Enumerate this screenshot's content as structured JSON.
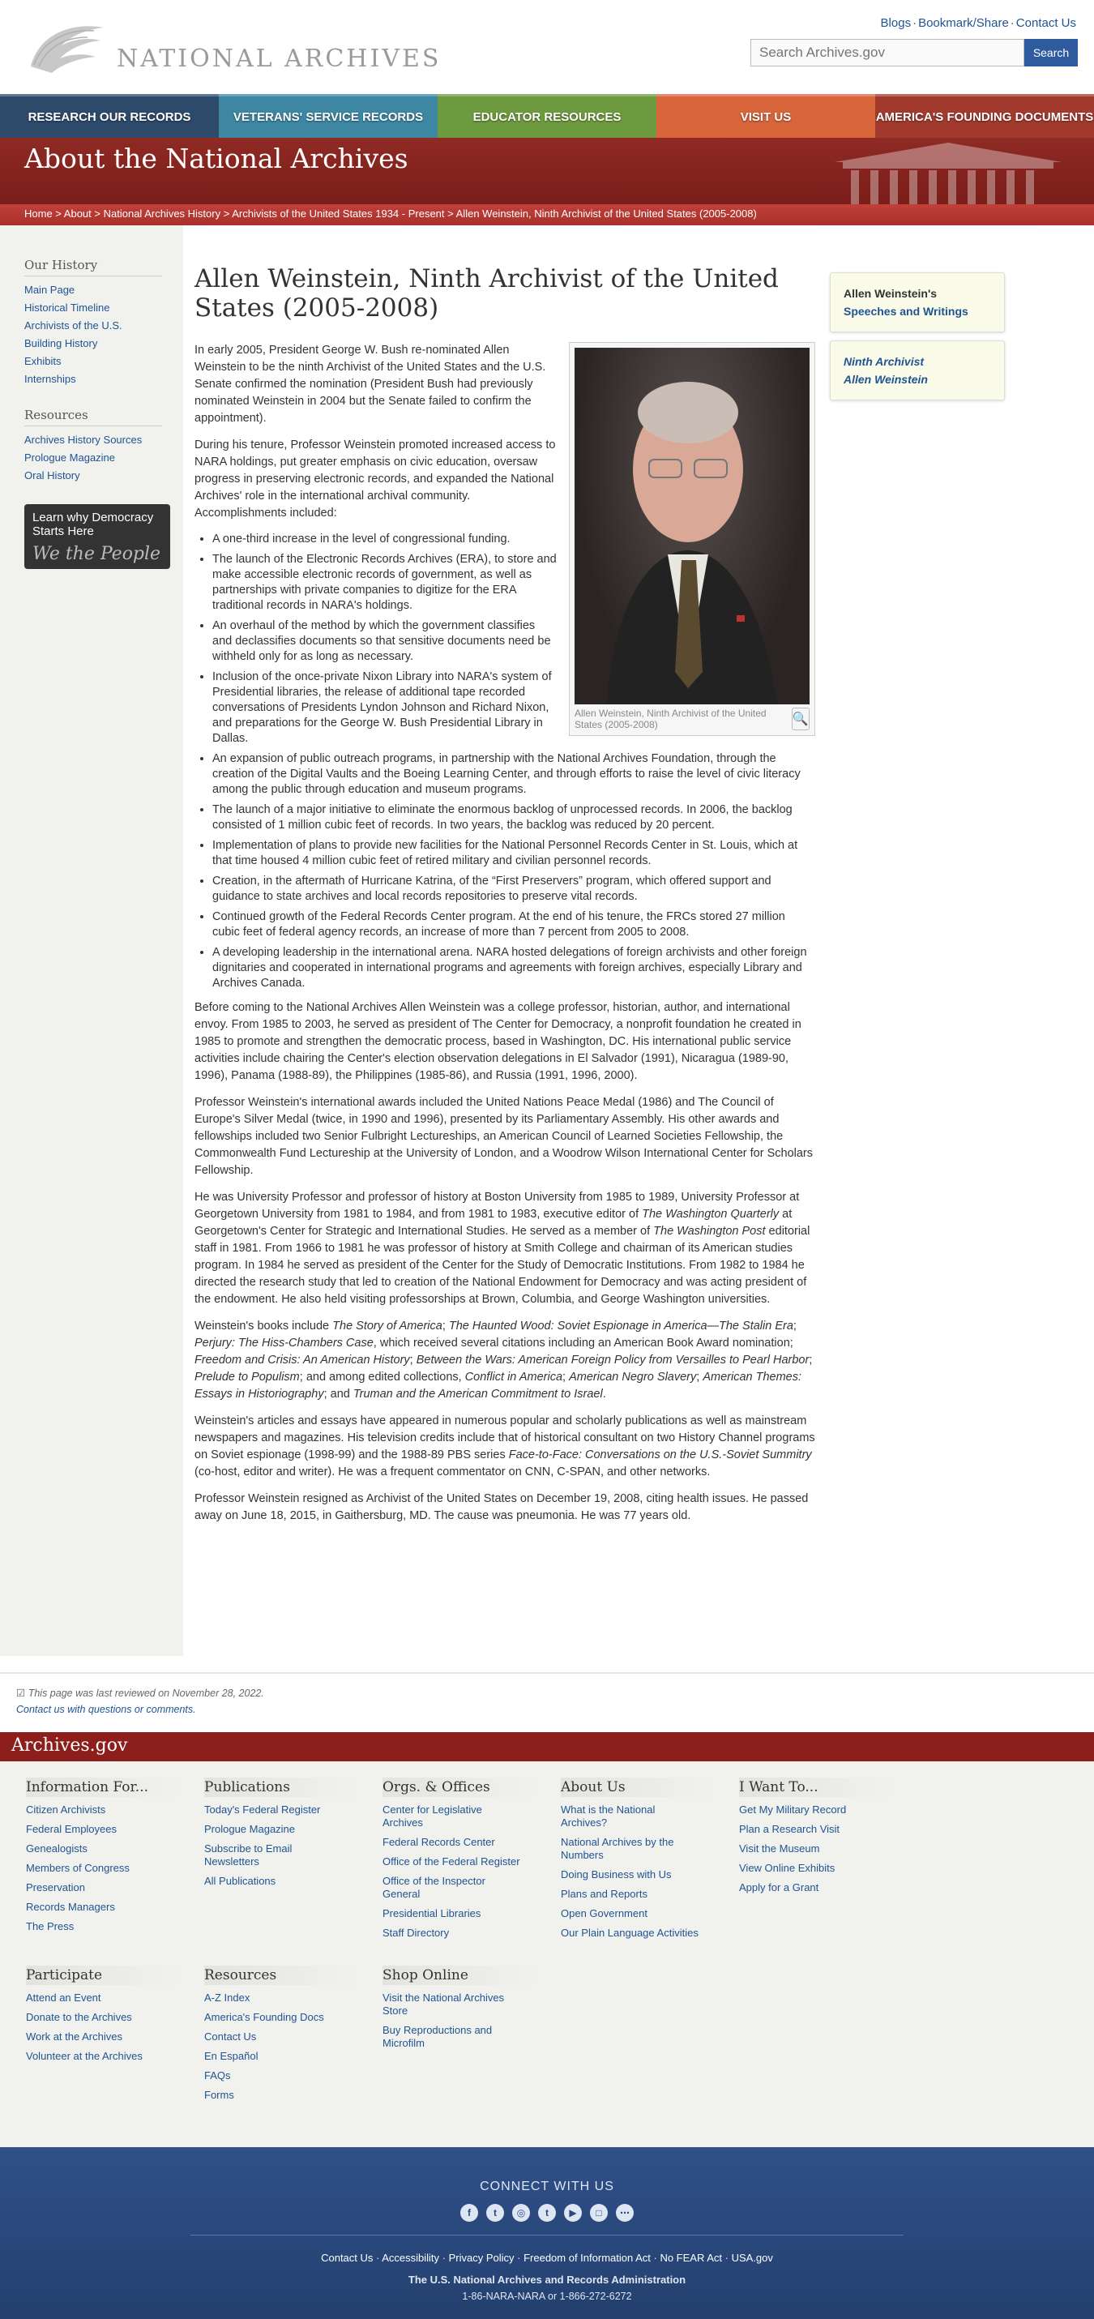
{
  "header": {
    "logo_text": "NATIONAL ARCHIVES",
    "toplinks": [
      "Blogs",
      "Bookmark/Share",
      "Contact Us"
    ],
    "search_placeholder": "Search Archives.gov",
    "search_button": "Search"
  },
  "nav": [
    {
      "label": "Research Our Records",
      "color": "#2d4a6b"
    },
    {
      "label": "Veterans' Service Records",
      "color": "#3d87a3"
    },
    {
      "label": "Educator Resources",
      "color": "#6e9a3f"
    },
    {
      "label": "Visit Us",
      "color": "#d9653b"
    },
    {
      "label": "America's Founding Documents",
      "color": "#a23a2e"
    }
  ],
  "banner": {
    "title": "About the National Archives",
    "breadcrumbs": [
      "Home",
      "About",
      "National Archives History",
      "Archivists of the United States 1934 - Present",
      "Allen Weinstein, Ninth Archivist of the United States (2005-2008)"
    ]
  },
  "sidebar": {
    "history_heading": "Our History",
    "history_links": [
      "Main Page",
      "Historical Timeline",
      "Archivists of the U.S.",
      "Building History",
      "Exhibits",
      "Internships"
    ],
    "resources_heading": "Resources",
    "resources_links": [
      "Archives History Sources",
      "Prologue Magazine",
      "Oral History"
    ],
    "promo_text": "Learn why Democracy Starts Here",
    "promo_sig": "We the People"
  },
  "main": {
    "title": "Allen Weinstein, Ninth Archivist of the United States (2005-2008)",
    "caption": "Allen Weinstein, Ninth Archivist of the United States (2005-2008)",
    "intro": "In early 2005, President George W. Bush re-nominated Allen Weinstein to be the ninth Archivist of the United States and the U.S. Senate confirmed the nomination (President Bush had previously nominated Weinstein in 2004 but the Senate failed to confirm the appointment).",
    "tenure": "During his tenure, Professor Weinstein promoted increased access to NARA holdings, put greater emphasis on civic education, oversaw progress in preserving electronic records, and expanded the National Archives' role in the international archival community. Accomplishments included:",
    "accomplishments": [
      "A one-third increase in the level of congressional funding.",
      "The launch of the Electronic Records Archives (ERA), to store and make accessible electronic records of government, as well as partnerships with private companies to digitize for the ERA traditional records in NARA's holdings.",
      "An overhaul of the method by which the government classifies and declassifies documents so that sensitive documents need be withheld only for as long as necessary.",
      "Inclusion of the once-private Nixon Library into NARA's system of Presidential libraries, the release of additional tape recorded conversations of Presidents Lyndon Johnson and Richard Nixon, and preparations for the George W. Bush Presidential Library in Dallas.",
      "An expansion of public outreach programs, in partnership with the National Archives Foundation, through the creation of the Digital Vaults and the Boeing Learning Center, and through efforts to raise the level of civic literacy among the public through education and museum programs.",
      "The launch of a major initiative to eliminate the enormous backlog of unprocessed records. In 2006, the backlog consisted of 1 million cubic feet of records. In two years, the backlog was reduced by 20 percent.",
      "Implementation of plans to provide new facilities for the National Personnel Records Center in St. Louis, which at that time housed 4 million cubic feet of retired military and civilian personnel records.",
      "Creation, in the aftermath of Hurricane Katrina, of the “First Preservers” program, which offered support and guidance to state archives and local records repositories to preserve vital records.",
      "Continued growth of the Federal Records Center program. At the end of his tenure, the FRCs stored 27 million cubic feet of federal agency records, an increase of more than 7 percent from 2005 to 2008.",
      "A developing leadership in the international arena. NARA hosted delegations of foreign archivists and other foreign dignitaries and cooperated in international programs and agreements with foreign archives, especially Library and Archives Canada."
    ],
    "p_before": "Before coming to the National Archives Allen Weinstein was a college professor, historian, author, and international envoy. From 1985 to 2003, he served as president of The Center for Democracy, a nonprofit foundation he created in 1985 to promote and strengthen the democratic process, based in Washington, DC. His international public service activities include chairing the Center's election observation delegations in El Salvador (1991), Nicaragua (1989-90, 1996), Panama (1988-89), the Philippines (1985-86), and Russia (1991, 1996, 2000).",
    "p_awards": "Professor Weinstein's international awards included the United Nations Peace Medal (1986) and The Council of Europe's Silver Medal (twice, in 1990 and 1996), presented by its Parliamentary Assembly. His other awards and fellowships included two Senior Fulbright Lectureships, an American Council of Learned Societies Fellowship, the Commonwealth Fund Lectureship at the University of London, and a Woodrow Wilson International Center for Scholars Fellowship.",
    "p_univ_a": "He was University Professor and professor of history at Boston University from 1985 to 1989, University Professor at Georgetown University from 1981 to 1984, and from 1981 to 1983, executive editor of ",
    "p_univ_i1": "The Washington Quarterly",
    "p_univ_b": " at Georgetown's Center for Strategic and International Studies. He served as a member of ",
    "p_univ_i2": "The Washington Post",
    "p_univ_c": " editorial staff in 1981. From 1966 to 1981 he was professor of history at Smith College and chairman of its American studies program. In 1984 he served as president of the Center for the Study of Democratic Institutions. From 1982 to 1984 he directed the research study that led to creation of the National Endowment for Democracy and was acting president of the endowment. He also held visiting professorships at Brown, Columbia, and George Washington universities.",
    "books": [
      {
        "t": "Weinstein's books include ",
        "i": false
      },
      {
        "t": "The Story of America",
        "i": true
      },
      {
        "t": "; ",
        "i": false
      },
      {
        "t": "The Haunted Wood: Soviet Espionage in America—The Stalin Era",
        "i": true
      },
      {
        "t": "; ",
        "i": false
      },
      {
        "t": "Perjury: The Hiss-Chambers Case",
        "i": true
      },
      {
        "t": ", which received several citations including an American Book Award nomination; ",
        "i": false
      },
      {
        "t": "Freedom and Crisis: An American History",
        "i": true
      },
      {
        "t": "; ",
        "i": false
      },
      {
        "t": "Between the Wars: American Foreign Policy from Versailles to Pearl Harbor",
        "i": true
      },
      {
        "t": "; ",
        "i": false
      },
      {
        "t": "Prelude to Populism",
        "i": true
      },
      {
        "t": "; and among edited collections, ",
        "i": false
      },
      {
        "t": "Conflict in America",
        "i": true
      },
      {
        "t": "; ",
        "i": false
      },
      {
        "t": "American Negro Slavery",
        "i": true
      },
      {
        "t": "; ",
        "i": false
      },
      {
        "t": "American Themes: Essays in Historiography",
        "i": true
      },
      {
        "t": "; and ",
        "i": false
      },
      {
        "t": "Truman and the American Commitment to Israel",
        "i": true
      },
      {
        "t": ".",
        "i": false
      }
    ],
    "p_articles_a": "Weinstein's articles and essays have appeared in numerous popular and scholarly publications as well as mainstream newspapers and magazines. His television credits include that of historical consultant on two History Channel programs on Soviet espionage (1998-99) and the 1988-89 PBS series ",
    "p_articles_i": "Face-to-Face: Conversations on the U.S.-Soviet Summitry",
    "p_articles_b": " (co-host, editor and writer). He was a frequent commentator on CNN, C-SPAN, and other networks.",
    "p_resigned": "Professor Weinstein resigned as Archivist of the United States on December 19, 2008, citing health issues. He passed away on June 18, 2015, in Gaithersburg, MD. The cause was pneumonia. He was 77 years old."
  },
  "right": {
    "box1_prefix": "Allen Weinstein's",
    "box1_link": "Speeches and Writings",
    "box2_line1": "Ninth Archivist",
    "box2_line2": "Allen Weinstein"
  },
  "review": {
    "reviewed": "This page was last reviewed on November 28, 2022.",
    "contact": "Contact us with questions or comments."
  },
  "footer": {
    "brand": "Archives.gov",
    "columns": [
      {
        "heading": "Information For...",
        "links": [
          "Citizen Archivists",
          "Federal Employees",
          "Genealogists",
          "Members of Congress",
          "Preservation",
          "Records Managers",
          "The Press"
        ]
      },
      {
        "heading": "Publications",
        "links": [
          "Today's Federal Register",
          "Prologue Magazine",
          "Subscribe to Email Newsletters",
          "All Publications"
        ]
      },
      {
        "heading": "Orgs. & Offices",
        "links": [
          "Center for Legislative Archives",
          "Federal Records Center",
          "Office of the Federal Register",
          "Office of the Inspector General",
          "Presidential Libraries",
          "Staff Directory"
        ]
      },
      {
        "heading": "About Us",
        "links": [
          "What is the National Archives?",
          "National Archives by the Numbers",
          "Doing Business with Us",
          "Plans and Reports",
          "Open Government",
          "Our Plain Language Activities"
        ]
      },
      {
        "heading": "I Want To...",
        "links": [
          "Get My Military Record",
          "Plan a Research Visit",
          "Visit the Museum",
          "View Online Exhibits",
          "Apply for a Grant"
        ]
      },
      {
        "heading": "Participate",
        "links": [
          "Attend an Event",
          "Donate to the Archives",
          "Work at the Archives",
          "Volunteer at the Archives"
        ]
      },
      {
        "heading": "Resources",
        "links": [
          "A-Z Index",
          "America's Founding Docs",
          "Contact Us",
          "En Español",
          "FAQs",
          "Forms"
        ]
      },
      {
        "heading": "Shop Online",
        "links": [
          "Visit the National Archives Store",
          "Buy Reproductions and Microfilm"
        ]
      }
    ],
    "connect": "CONNECT WITH US",
    "social": [
      "facebook-icon",
      "twitter-icon",
      "instagram-icon",
      "tumblr-icon",
      "youtube-icon",
      "blog-icon",
      "more-icon"
    ],
    "links": [
      "Contact Us",
      "Accessibility",
      "Privacy Policy",
      "Freedom of Information Act",
      "No FEAR Act",
      "USA.gov"
    ],
    "org": "The U.S. National Archives and Records Administration",
    "phone": "1-86-NARA-NARA or 1-866-272-6272"
  }
}
